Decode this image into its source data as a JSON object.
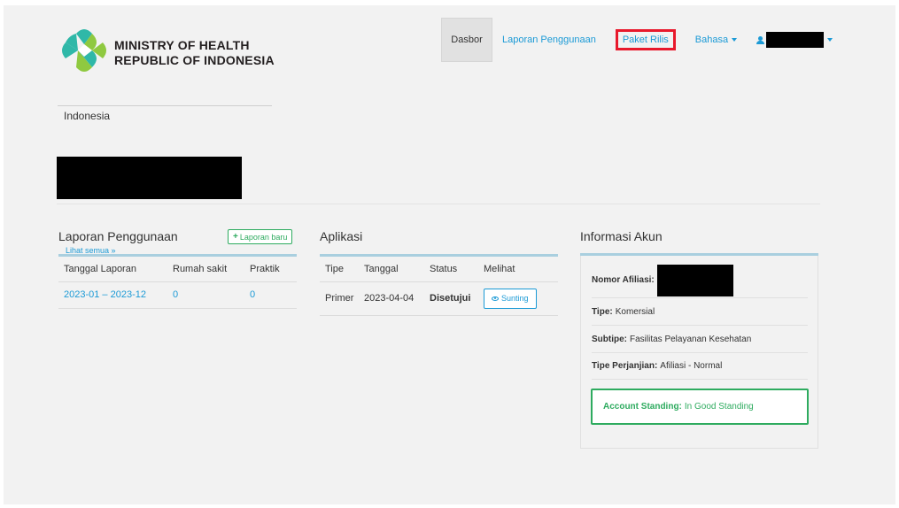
{
  "header": {
    "logo_line1": "MINISTRY OF HEALTH",
    "logo_line2": "REPUBLIC OF INDONESIA",
    "nav": {
      "dashboard": "Dasbor",
      "usage_reports": "Laporan Penggunaan",
      "release_packages": "Paket Rilis",
      "language": "Bahasa"
    }
  },
  "profile": {
    "country": "Indonesia"
  },
  "usage_reports": {
    "title": "Laporan Penggunaan",
    "new_button": "Laporan baru",
    "see_all": "Lihat semua »",
    "columns": [
      "Tanggal Laporan",
      "Rumah sakit",
      "Praktik"
    ],
    "rows": [
      {
        "period": "2023-01 – 2023-12",
        "hospitals": "0",
        "practices": "0"
      }
    ]
  },
  "applications": {
    "title": "Aplikasi",
    "columns": [
      "Tipe",
      "Tanggal",
      "Status",
      "Melihat"
    ],
    "rows": [
      {
        "type": "Primer",
        "date": "2023-04-04",
        "status": "Disetujui",
        "action": "Sunting"
      }
    ]
  },
  "account": {
    "title": "Informasi Akun",
    "affiliate_label": "Nomor Afiliasi:",
    "type_label": "Tipe:",
    "type_value": "Komersial",
    "subtype_label": "Subtipe:",
    "subtype_value": "Fasilitas Pelayanan Kesehatan",
    "agreement_label": "Tipe Perjanjian:",
    "agreement_value": "Afiliasi - Normal",
    "standing_label": "Account Standing:",
    "standing_value": "In Good Standing"
  },
  "colors": {
    "link": "#1b9ad6",
    "success": "#2eab5f",
    "highlight": "#e8192c"
  }
}
